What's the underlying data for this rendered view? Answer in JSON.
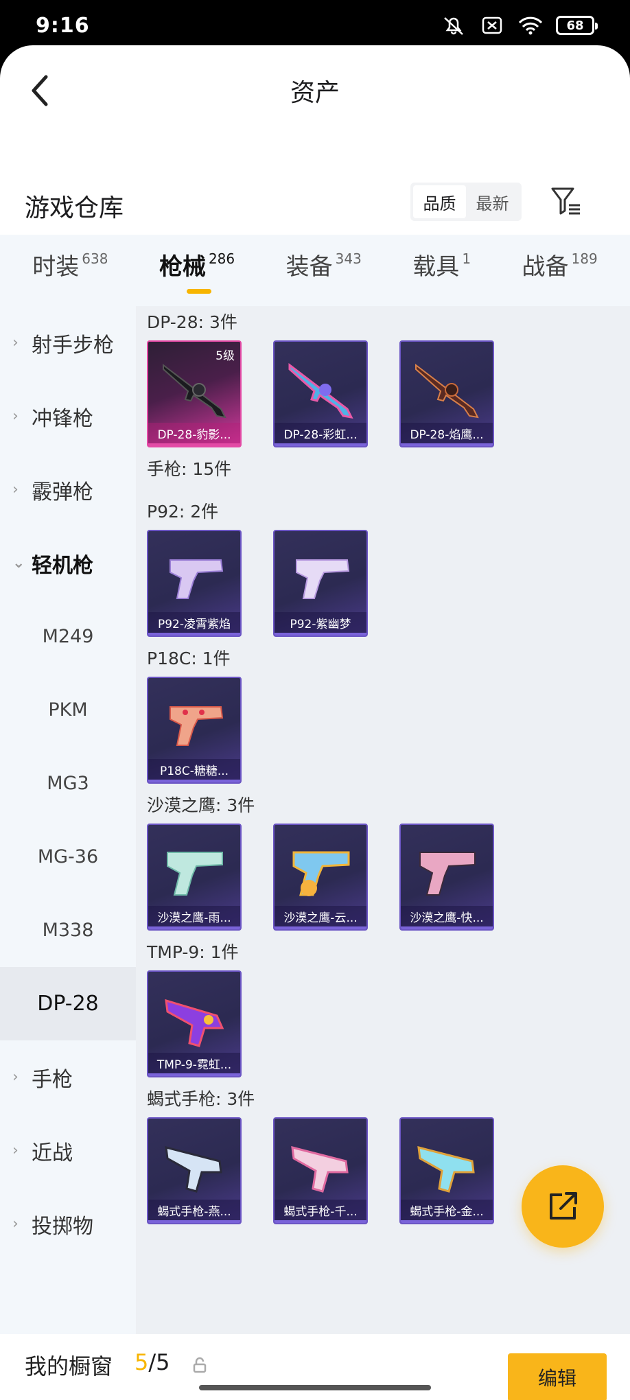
{
  "status_bar": {
    "time": "9:16",
    "battery": "68"
  },
  "nav": {
    "title": "资产"
  },
  "warehouse": {
    "title": "游戏仓库",
    "sort_options": [
      "品质",
      "最新"
    ]
  },
  "tabs": [
    {
      "label": "时装",
      "count": "638"
    },
    {
      "label": "枪械",
      "count": "286"
    },
    {
      "label": "装备",
      "count": "343"
    },
    {
      "label": "载具",
      "count": "1"
    },
    {
      "label": "战备",
      "count": "189"
    }
  ],
  "sidebar": [
    {
      "label": "射手步枪"
    },
    {
      "label": "冲锋枪"
    },
    {
      "label": "霰弹枪"
    },
    {
      "label": "轻机枪"
    },
    {
      "label": "M249"
    },
    {
      "label": "PKM"
    },
    {
      "label": "MG3"
    },
    {
      "label": "MG-36"
    },
    {
      "label": "M338"
    },
    {
      "label": "DP-28"
    },
    {
      "label": "手枪"
    },
    {
      "label": "近战"
    },
    {
      "label": "投掷物"
    }
  ],
  "groups": {
    "dp28": {
      "title": "DP-28: 3件",
      "items": [
        {
          "label": "DP-28-豹影...",
          "level": "5级"
        },
        {
          "label": "DP-28-彩虹..."
        },
        {
          "label": "DP-28-焰鹰..."
        }
      ]
    },
    "pistol": {
      "title": "手枪: 15件"
    },
    "p92": {
      "title": "P92: 2件",
      "items": [
        {
          "label": "P92-凌霄紫焰"
        },
        {
          "label": "P92-紫幽梦"
        }
      ]
    },
    "p18c": {
      "title": "P18C: 1件",
      "items": [
        {
          "label": "P18C-糖糖..."
        }
      ]
    },
    "deagle": {
      "title": "沙漠之鹰: 3件",
      "items": [
        {
          "label": "沙漠之鹰-雨..."
        },
        {
          "label": "沙漠之鹰-云..."
        },
        {
          "label": "沙漠之鹰-快..."
        }
      ]
    },
    "tmp9": {
      "title": "TMP-9: 1件",
      "items": [
        {
          "label": "TMP-9-霓虹..."
        }
      ]
    },
    "scorpion": {
      "title": "蝎式手枪: 3件",
      "items": [
        {
          "label": "蝎式手枪-燕..."
        },
        {
          "label": "蝎式手枪-千..."
        },
        {
          "label": "蝎式手枪-金..."
        }
      ]
    }
  },
  "showcase": {
    "title": "我的橱窗",
    "current": "5",
    "sep": "/",
    "max": "5"
  },
  "edit_label": "编辑",
  "colors": {
    "accent": "#f9b51a",
    "sidebar_bg": "#f3f7fb",
    "content_bg": "#edf0f4"
  }
}
